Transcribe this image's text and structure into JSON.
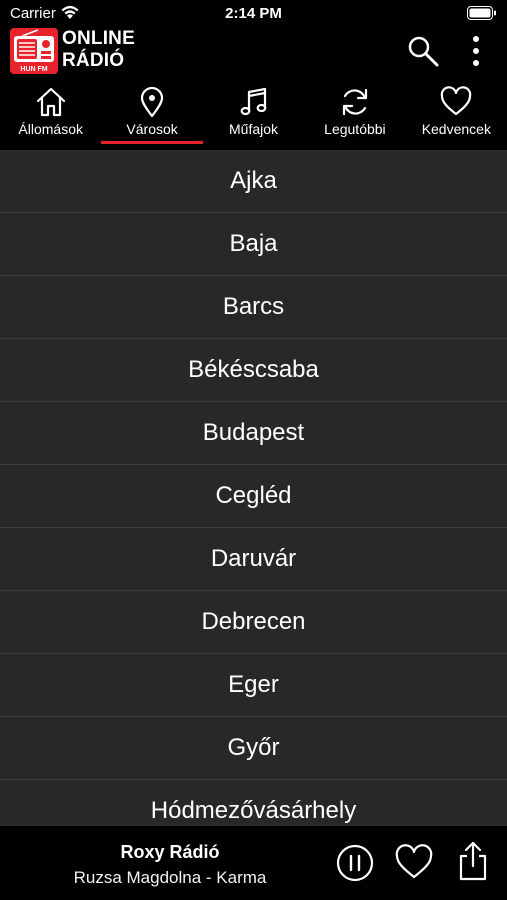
{
  "status_bar": {
    "carrier": "Carrier",
    "time": "2:14 PM",
    "wifi_icon": "wifi-icon",
    "battery_icon": "battery-icon"
  },
  "header": {
    "logo_text": "HUN FM",
    "brand_line1": "ONLINE",
    "brand_line2": "RÁDIÓ",
    "icons": [
      "search-icon",
      "more-vertical-icon"
    ],
    "accent_color": "#e8232b"
  },
  "tabs": [
    {
      "label": "Állomások",
      "icon": "home-icon",
      "selected": false
    },
    {
      "label": "Városok",
      "icon": "location-pin-icon",
      "selected": true
    },
    {
      "label": "Műfajok",
      "icon": "music-note-icon",
      "selected": false
    },
    {
      "label": "Legutóbbi",
      "icon": "refresh-icon",
      "selected": false
    },
    {
      "label": "Kedvencek",
      "icon": "heart-icon",
      "selected": false
    }
  ],
  "cities": [
    "Ajka",
    "Baja",
    "Barcs",
    "Békéscsaba",
    "Budapest",
    "Cegléd",
    "Daruvár",
    "Debrecen",
    "Eger",
    "Győr",
    "Hódmezővásárhely"
  ],
  "player": {
    "station": "Roxy Rádió",
    "track": "Ruzsa Magdolna - Karma",
    "icons": [
      "pause-icon",
      "heart-icon",
      "share-icon"
    ]
  }
}
